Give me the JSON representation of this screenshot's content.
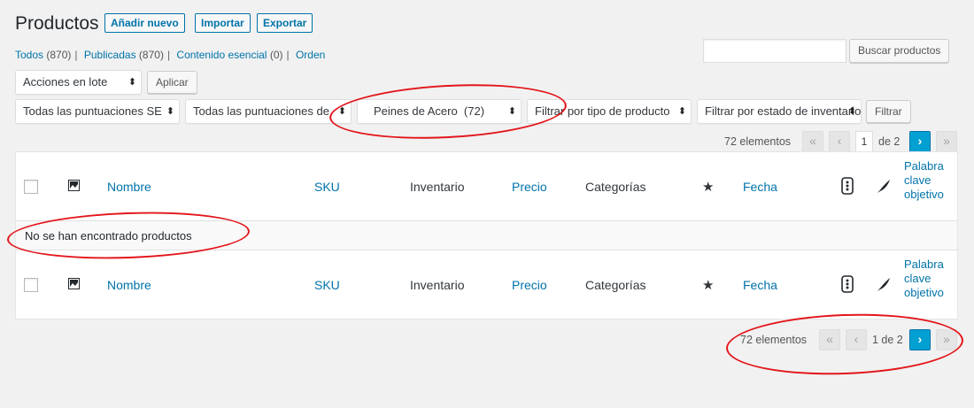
{
  "header": {
    "title": "Productos",
    "buttons": [
      "Añadir nuevo",
      "Importar",
      "Exportar"
    ]
  },
  "views": [
    {
      "label": "Todos",
      "count": "(870)"
    },
    {
      "label": "Publicadas",
      "count": "(870)"
    },
    {
      "label": "Contenido esencial",
      "count": "(0)"
    },
    {
      "label": "Orden",
      "count": ""
    }
  ],
  "search": {
    "placeholder": "",
    "button": "Buscar productos"
  },
  "bulk": {
    "select": "Acciones en lote",
    "apply": "Aplicar"
  },
  "filters": {
    "score1": "Todas las puntuaciones SE",
    "score2": "Todas las puntuaciones de",
    "category": "Peines de Acero  (72)",
    "type": "Filtrar por tipo de producto",
    "stock": "Filtrar por estado de inventario",
    "button": "Filtrar"
  },
  "pagination_top": {
    "count": "72 elementos",
    "first": "«",
    "prev": "‹",
    "page": "1",
    "of": "de 2",
    "next": "›",
    "last": "»"
  },
  "pagination_bottom": {
    "count": "72 elementos",
    "first": "«",
    "prev": "‹",
    "page_text": "1 de 2",
    "next": "›",
    "last": "»"
  },
  "table": {
    "columns": {
      "name": "Nombre",
      "sku": "SKU",
      "stock": "Inventario",
      "price": "Precio",
      "categories": "Categorías",
      "featured": "★",
      "date": "Fecha",
      "kw1": "Palabra",
      "kw2": "clave",
      "kw3": "objetivo"
    },
    "empty_message": "No se han encontrado productos"
  },
  "colors": {
    "accent": "#0073aa",
    "annotation": "#e3151a",
    "active_page": "#00a0d2"
  }
}
